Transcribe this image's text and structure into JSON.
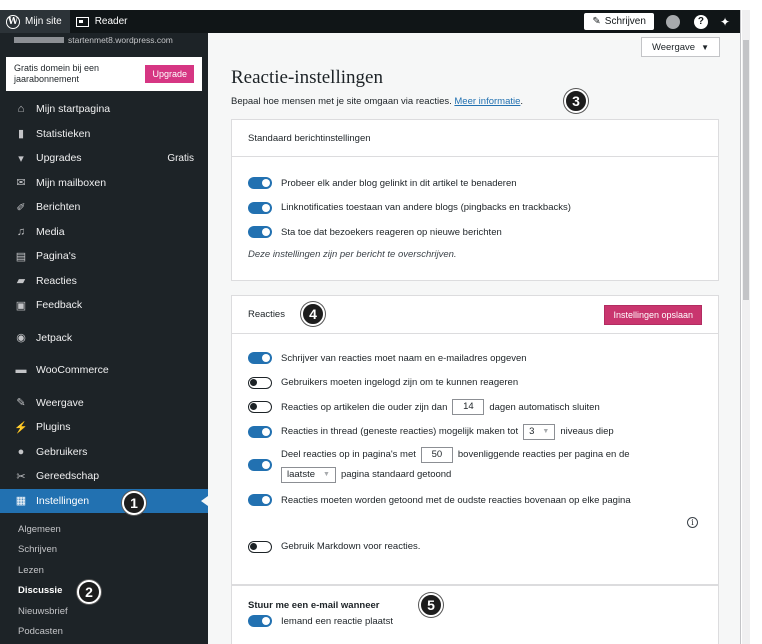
{
  "adminbar": {
    "my_site": "Mijn site",
    "reader": "Reader",
    "write": "Schrijven"
  },
  "sidebar": {
    "site_url": "startenmet8.wordpress.com",
    "promo_text": "Gratis domein bij een jaarabonnement",
    "upgrade_label": "Upgrade",
    "items": [
      {
        "label": "Mijn startpagina",
        "icon": "home-icon"
      },
      {
        "label": "Statistieken",
        "icon": "stats-icon"
      },
      {
        "label": "Upgrades",
        "icon": "cart-icon",
        "badge": "Gratis"
      },
      {
        "label": "Mijn mailboxen",
        "icon": "mail-icon"
      },
      {
        "label": "Berichten",
        "icon": "pin-icon"
      },
      {
        "label": "Media",
        "icon": "media-icon"
      },
      {
        "label": "Pagina's",
        "icon": "pages-icon"
      },
      {
        "label": "Reacties",
        "icon": "comment-icon"
      },
      {
        "label": "Feedback",
        "icon": "feedback-icon"
      },
      {
        "label": "Jetpack",
        "icon": "jetpack-icon"
      },
      {
        "label": "WooCommerce",
        "icon": "woo-icon"
      },
      {
        "label": "Weergave",
        "icon": "brush-icon"
      },
      {
        "label": "Plugins",
        "icon": "plugin-icon"
      },
      {
        "label": "Gebruikers",
        "icon": "user-icon"
      },
      {
        "label": "Gereedschap",
        "icon": "wrench-icon"
      },
      {
        "label": "Instellingen",
        "icon": "settings-icon"
      }
    ],
    "subitems": [
      "Algemeen",
      "Schrijven",
      "Lezen",
      "Discussie",
      "Nieuwsbrief",
      "Podcasten"
    ]
  },
  "main": {
    "view_label": "Weergave",
    "title": "Reactie-instellingen",
    "subtitle": "Bepaal hoe mensen met je site omgaan via reacties.",
    "more_link": "Meer informatie",
    "subtitle_end": "."
  },
  "card1": {
    "title": "Standaard berichtinstellingen",
    "rows": [
      "Probeer elk ander blog gelinkt in dit artikel te benaderen",
      "Linknotificaties toestaan van andere blogs (pingbacks en trackbacks)",
      "Sta toe dat bezoekers reageren op nieuwe berichten"
    ],
    "note": "Deze instellingen zijn per bericht te overschrijven."
  },
  "card2": {
    "title": "Reacties",
    "save_label": "Instellingen opslaan",
    "row1": "Schrijver van reacties moet naam en e-mailadres opgeven",
    "row2": "Gebruikers moeten ingelogd zijn om te kunnen reageren",
    "row3_a": "Reacties op artikelen die ouder zijn dan",
    "row3_value": "14",
    "row3_b": "dagen automatisch sluiten",
    "row4_a": "Reacties in thread (geneste reacties) mogelijk maken tot",
    "row4_value": "3",
    "row4_b": "niveaus diep",
    "row5_a": "Deel reacties op in pagina's met",
    "row5_value": "50",
    "row5_b": "bovenliggende reacties per pagina en de",
    "row5_select": "laatste",
    "row5_c": "pagina standaard getoond",
    "row6": "Reacties moeten worden getoond met de oudste reacties bovenaan op elke pagina",
    "row7": "Gebruik Markdown voor reacties."
  },
  "card3": {
    "title": "Stuur me een e-mail wanneer",
    "row1": "Iemand een reactie plaatst"
  },
  "callouts": [
    "1",
    "2",
    "3",
    "4",
    "5"
  ],
  "colors": {
    "accent": "#2271b1",
    "sidebar": "#1d2327",
    "upgrade": "#d63683",
    "save": "#c9356e"
  }
}
